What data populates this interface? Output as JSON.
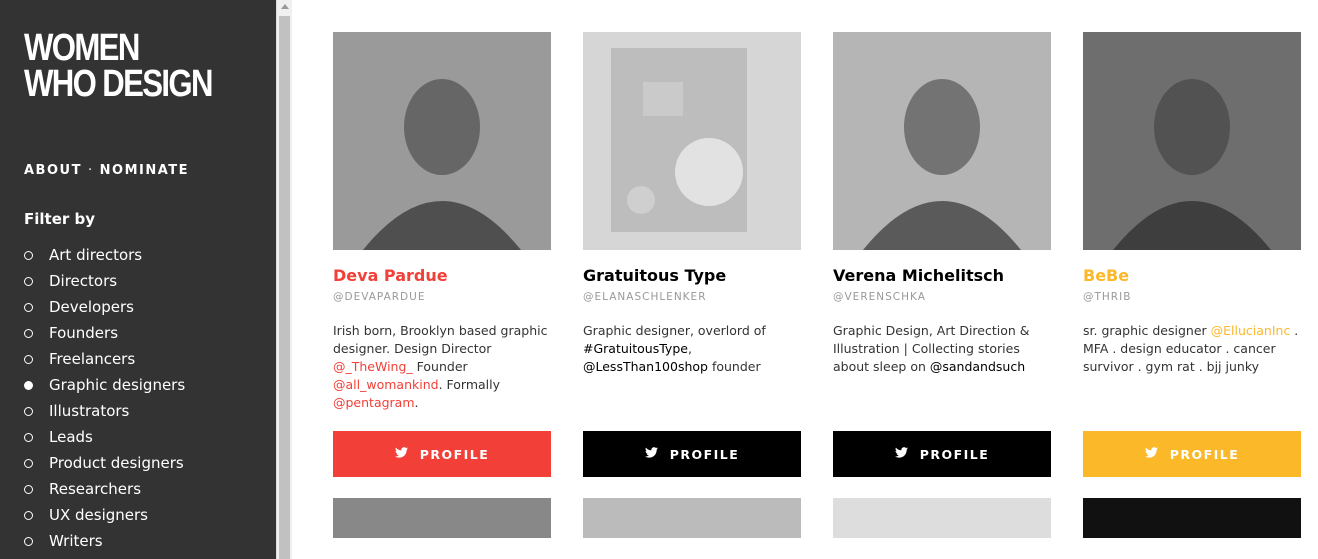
{
  "site": {
    "logo_line1": "WOMEN",
    "logo_line2": "WHO DESIGN",
    "nav_about": "ABOUT",
    "nav_sep": "·",
    "nav_nominate": "NOMINATE"
  },
  "filter": {
    "title": "Filter by",
    "items": [
      {
        "label": "Art directors",
        "checked": false
      },
      {
        "label": "Directors",
        "checked": false
      },
      {
        "label": "Developers",
        "checked": false
      },
      {
        "label": "Founders",
        "checked": false
      },
      {
        "label": "Freelancers",
        "checked": false
      },
      {
        "label": "Graphic designers",
        "checked": true
      },
      {
        "label": "Illustrators",
        "checked": false
      },
      {
        "label": "Leads",
        "checked": false
      },
      {
        "label": "Product designers",
        "checked": false
      },
      {
        "label": "Researchers",
        "checked": false
      },
      {
        "label": "UX designers",
        "checked": false
      },
      {
        "label": "Writers",
        "checked": false
      }
    ]
  },
  "colors": {
    "accent_red": "#f23f37",
    "accent_yellow": "#fbb829",
    "black": "#000000",
    "sidebar": "#333333"
  },
  "profile_label": "PROFILE",
  "cards": [
    {
      "name": "Deva Pardue",
      "handle": "@DEVAPARDUE",
      "name_color": "#f23f37",
      "button_color": "#f23f37",
      "bio": [
        {
          "t": "Irish born, Brooklyn based graphic designer. Design Director "
        },
        {
          "t": "@_TheWing_",
          "link": true
        },
        {
          "t": " Founder "
        },
        {
          "t": "@all_womankind",
          "link": true
        },
        {
          "t": ". Formally "
        },
        {
          "t": "@pentagram",
          "link": true
        },
        {
          "t": "."
        }
      ]
    },
    {
      "name": "Gratuitous Type",
      "handle": "@ELANASCHLENKER",
      "name_color": "#000000",
      "button_color": "#000000",
      "bio": [
        {
          "t": "Graphic designer, overlord of "
        },
        {
          "t": "#GratuitousType",
          "link": true
        },
        {
          "t": ", "
        },
        {
          "t": "@LessThan100shop",
          "link": true
        },
        {
          "t": " founder"
        }
      ]
    },
    {
      "name": "Verena Michelitsch",
      "handle": "@VERENSCHKA",
      "name_color": "#000000",
      "button_color": "#000000",
      "bio": [
        {
          "t": "Graphic Design, Art Direction & Illustration | Collecting stories about sleep on "
        },
        {
          "t": "@sandandsuch",
          "link": true
        }
      ]
    },
    {
      "name": "BeBe",
      "handle": "@THRIB",
      "name_color": "#fbb829",
      "button_color": "#fbb829",
      "bio": [
        {
          "t": "sr. graphic designer "
        },
        {
          "t": "@EllucianInc",
          "link": true
        },
        {
          "t": " . MFA . design educator . cancer survivor . gym rat . bjj junky"
        }
      ]
    }
  ]
}
